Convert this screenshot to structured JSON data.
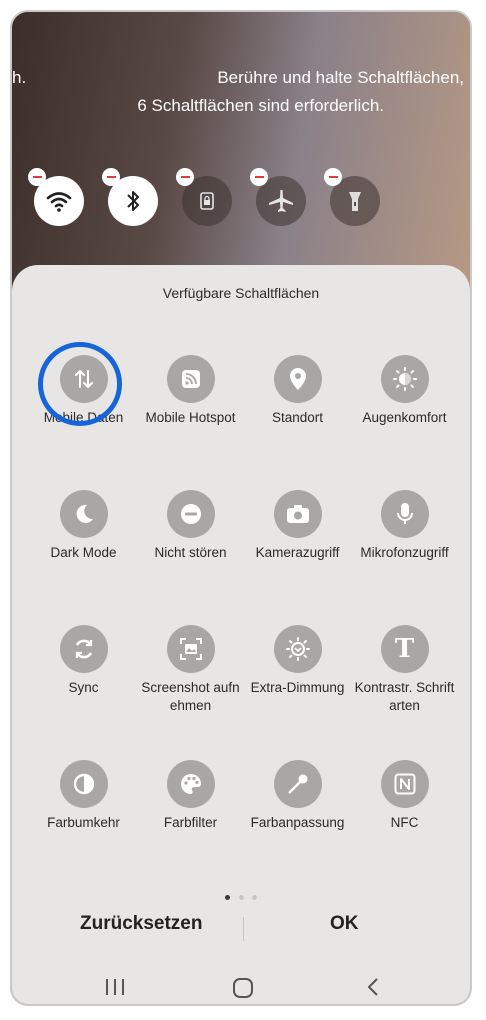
{
  "hints": {
    "left_fragment": "h.",
    "line1": "Berühre und halte Schaltflächen,",
    "line2": "6 Schaltflächen sind erforderlich."
  },
  "active_buttons": [
    {
      "icon": "wifi-icon",
      "state": "on"
    },
    {
      "icon": "bluetooth-icon",
      "state": "on"
    },
    {
      "icon": "lock-rotation-icon",
      "state": "off"
    },
    {
      "icon": "airplane-icon",
      "state": "off"
    },
    {
      "icon": "flashlight-icon",
      "state": "off"
    }
  ],
  "sheet": {
    "title": "Verfügbare Schaltflächen",
    "tiles": [
      {
        "icon": "mobile-data-icon",
        "label": "Mobile Daten"
      },
      {
        "icon": "mobile-hotspot-icon",
        "label": "Mobile Hotspot"
      },
      {
        "icon": "location-icon",
        "label": "Standort"
      },
      {
        "icon": "eye-comfort-icon",
        "label": "Augenkomfort"
      },
      {
        "icon": "dark-mode-icon",
        "label": "Dark Mode"
      },
      {
        "icon": "do-not-disturb-icon",
        "label": "Nicht stören"
      },
      {
        "icon": "camera-access-icon",
        "label": "Kamerazugriff"
      },
      {
        "icon": "microphone-access-icon",
        "label": "Mikrofonzugriff"
      },
      {
        "icon": "sync-icon",
        "label": "Sync"
      },
      {
        "icon": "screenshot-icon",
        "label": "Screenshot aufnehmen"
      },
      {
        "icon": "extra-dim-icon",
        "label": "Extra-Dimmung"
      },
      {
        "icon": "bold-font-icon",
        "label": "Kontrastr. Schriftarten"
      },
      {
        "icon": "color-inversion-icon",
        "label": "Farbumkehr"
      },
      {
        "icon": "color-filter-icon",
        "label": "Farbfilter"
      },
      {
        "icon": "color-adjustment-icon",
        "label": "Farbanpassung"
      },
      {
        "icon": "nfc-icon",
        "label": "NFC"
      }
    ],
    "page_indicator": {
      "pages": 3,
      "current": 1
    }
  },
  "actions": {
    "reset_label": "Zurücksetzen",
    "ok_label": "OK"
  },
  "colors": {
    "highlight": "#1565d8",
    "remove_badge": "#e0393e",
    "tile_icon_bg": "#a9a7a6"
  }
}
